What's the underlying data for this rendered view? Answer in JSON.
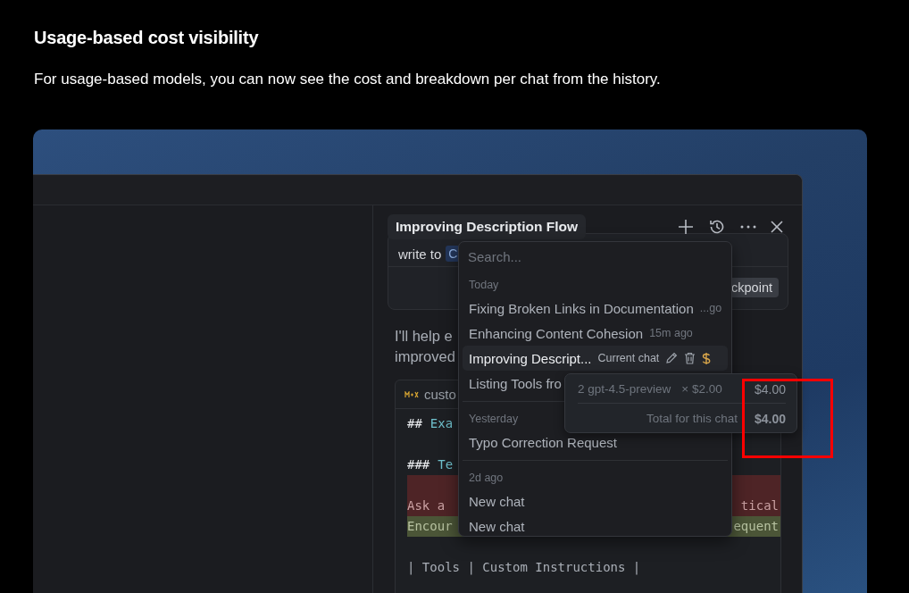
{
  "heading": "Usage-based cost visibility",
  "description": "For usage-based models, you can now see the cost and breakdown per chat from the history.",
  "panel": {
    "title": "Improving Description Flow"
  },
  "chat": {
    "message_prefix": "write to",
    "badge": "C",
    "checkpoint": "ckpoint",
    "reply_lines": [
      "I'll help e",
      "improved"
    ],
    "code_file": "custo",
    "code_lines": [
      {
        "kind": "heading",
        "hash": "##",
        "text": "Exa"
      },
      {
        "kind": "blank"
      },
      {
        "kind": "heading",
        "hash": "###",
        "text": "Te"
      },
      {
        "kind": "removed"
      },
      {
        "kind": "removed",
        "left": "Ask a",
        "right": "tical"
      },
      {
        "kind": "added",
        "left": "Encour",
        "right": "equent"
      },
      {
        "kind": "blank"
      },
      {
        "kind": "plain",
        "left": "| Tools | Custom Instructions |"
      }
    ]
  },
  "history": {
    "placeholder": "Search...",
    "groups": [
      {
        "label": "Today",
        "items": [
          {
            "title": "Fixing Broken Links in Documentation",
            "time": "...go",
            "selected": false
          },
          {
            "title": "Enhancing Content Cohesion",
            "time": "15m ago",
            "selected": false
          },
          {
            "title": "Improving Descript...",
            "time": "Current chat",
            "selected": true
          },
          {
            "title": "Listing Tools fro",
            "selected": false
          }
        ]
      },
      {
        "label": "Yesterday",
        "items": [
          {
            "title": "Typo Correction Request",
            "selected": false
          }
        ]
      },
      {
        "label": "2d ago",
        "items": [
          {
            "title": "New chat",
            "selected": false
          },
          {
            "title": "New chat",
            "selected": false
          }
        ]
      }
    ]
  },
  "cost": {
    "rows": [
      {
        "label": "2 gpt-4.5-preview",
        "rate": "× $2.00",
        "amount": "$4.00"
      }
    ],
    "total": {
      "label": "Total for this chat",
      "amount": "$4.00"
    }
  }
}
